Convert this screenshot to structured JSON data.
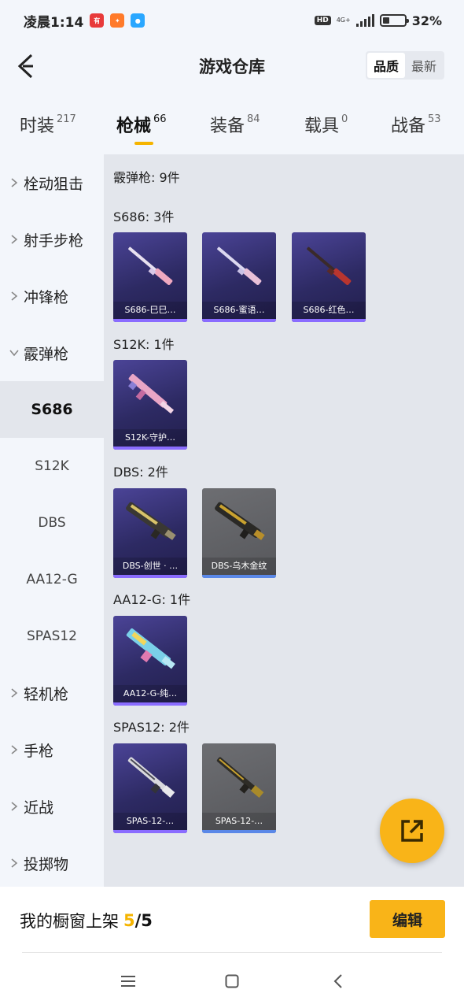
{
  "status": {
    "time": "凌晨1:14",
    "notif1": "有",
    "hd": "HD",
    "network": "4G+",
    "battery": "32%",
    "battery_level": 0.32
  },
  "header": {
    "title": "游戏仓库",
    "sort_quality": "品质",
    "sort_newest": "最新"
  },
  "tabs": [
    {
      "label": "时装",
      "count": "217"
    },
    {
      "label": "枪械",
      "count": "66"
    },
    {
      "label": "装备",
      "count": "84"
    },
    {
      "label": "载具",
      "count": "0"
    },
    {
      "label": "战备",
      "count": "53"
    }
  ],
  "sidebar": {
    "categories": [
      "栓动狙击",
      "射手步枪",
      "冲锋枪",
      "霰弹枪",
      "轻机枪",
      "手枪",
      "近战",
      "投掷物"
    ],
    "subcategories": [
      "S686",
      "S12K",
      "DBS",
      "AA12-G",
      "SPAS12"
    ]
  },
  "content": {
    "total": "霰弹枪: 9件",
    "groups": [
      {
        "title": "S686: 3件",
        "items": [
          "S686-巳巳…",
          "S686-蜜语…",
          "S686-红色…"
        ]
      },
      {
        "title": "S12K: 1件",
        "items": [
          "S12K-守护…"
        ]
      },
      {
        "title": "DBS: 2件",
        "items": [
          "DBS-创世 · …",
          "DBS-乌木金纹"
        ]
      },
      {
        "title": "AA12-G: 1件",
        "items": [
          "AA12-G-纯…"
        ]
      },
      {
        "title": "SPAS12: 2件",
        "items": [
          "SPAS-12-…",
          "SPAS-12-…"
        ]
      }
    ]
  },
  "bottom": {
    "showcase_label": "我的橱窗上架",
    "current": "5",
    "slash": "/",
    "max": "5",
    "edit": "编辑"
  },
  "colors": {
    "accent": "#f9b418",
    "epic": "#2d2a63",
    "common": "#56575b"
  }
}
